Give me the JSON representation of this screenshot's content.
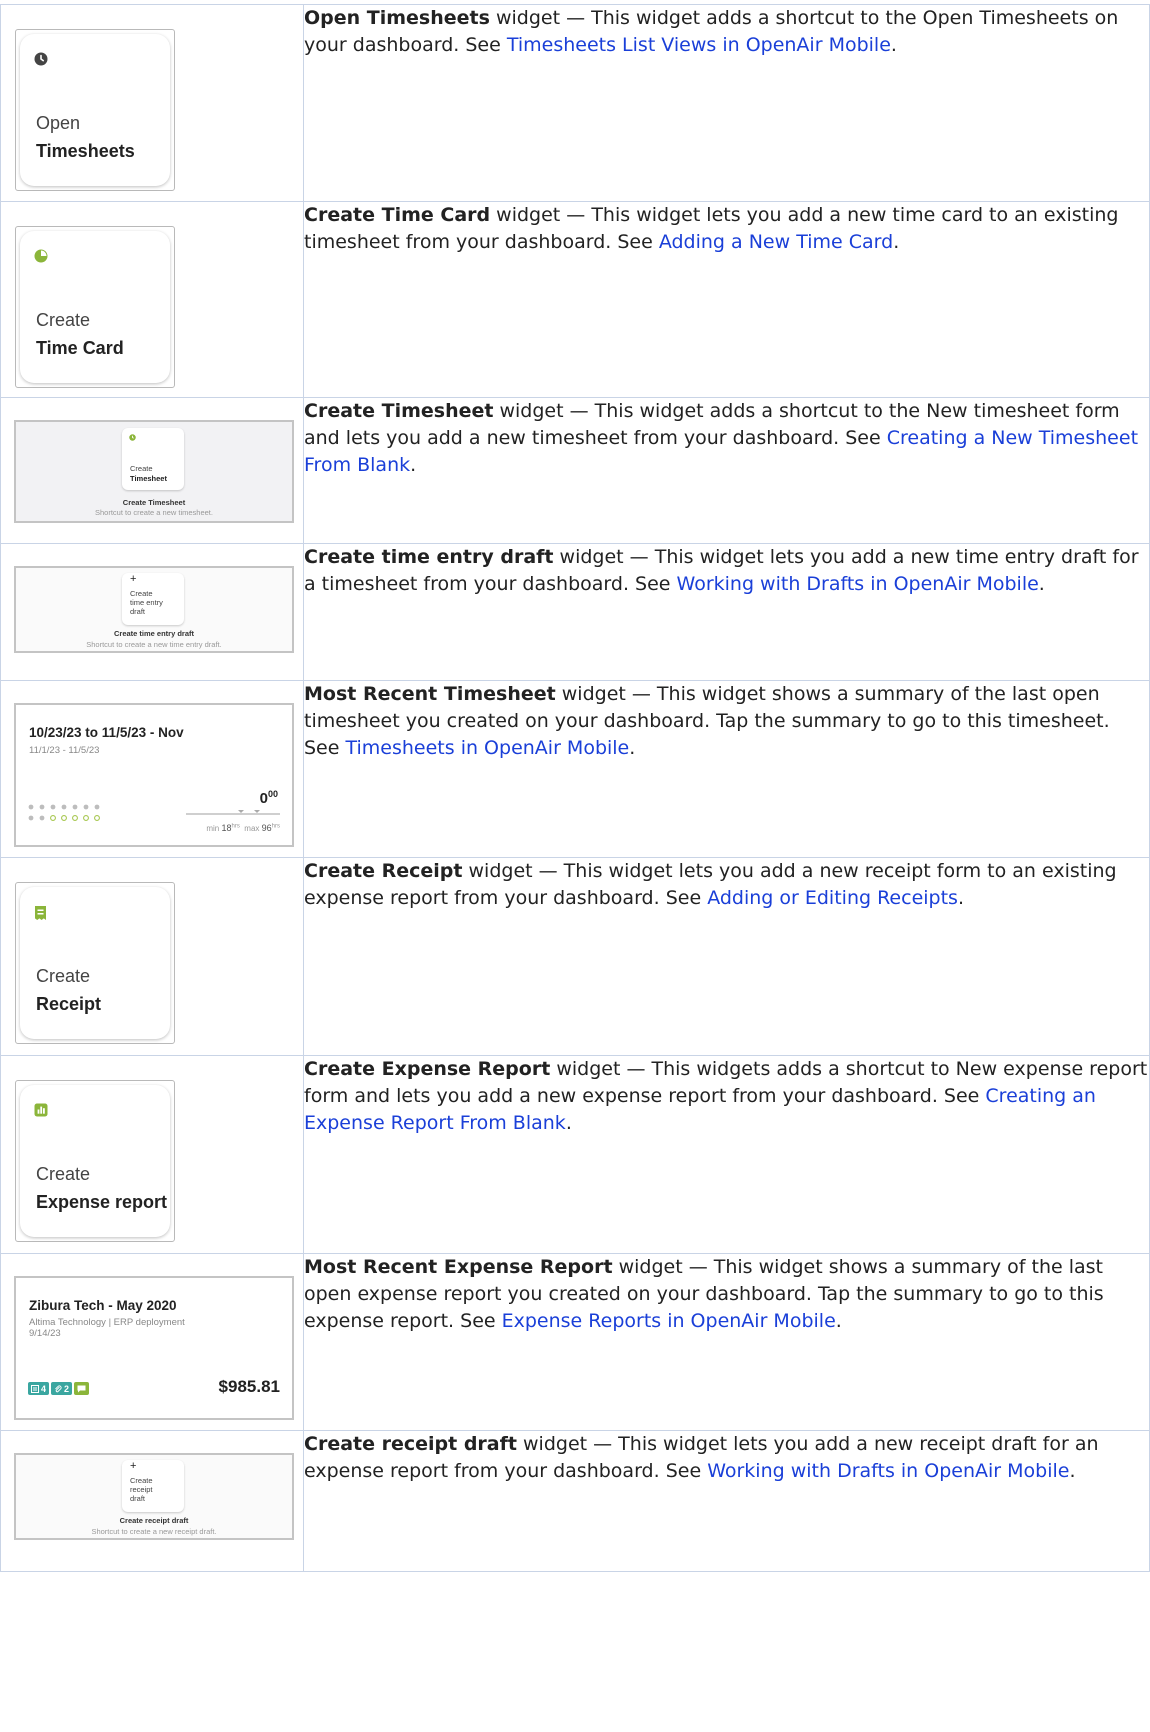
{
  "rows": [
    {
      "widget_name": "Open Timesheets",
      "text_before": " widget — This widget adds a shortcut to the Open Timesheets on your dashboard. See ",
      "link": "Timesheets List Views in OpenAir Mobile",
      "text_after": ".",
      "image": {
        "line1": "Open",
        "line2": "Timesheets",
        "icon": "clock-icon",
        "icon_color": "#444444"
      }
    },
    {
      "widget_name": "Create Time Card",
      "text_before": " widget — This widget lets you add a new time card to an existing timesheet from your dashboard. See ",
      "link": "Adding a New Time Card",
      "text_after": ".",
      "image": {
        "line1": "Create",
        "line2": "Time Card",
        "icon": "pie-clock-icon",
        "icon_color": "#8bb53a"
      }
    },
    {
      "widget_name": "Create Timesheet",
      "text_before": " widget — This widget adds a shortcut to the New timesheet form and lets you add a new timesheet from your dashboard. See ",
      "link": "Creating a New Timesheet From Blank",
      "text_after": ".",
      "image": {
        "line1": "Create",
        "line2": "Timesheet",
        "caption": "Create Timesheet",
        "subcaption": "Shortcut to create a new timesheet.",
        "icon": "clock-icon",
        "icon_color": "#8bb53a"
      }
    },
    {
      "widget_name": "Create time entry draft",
      "text_before": " widget — This widget lets you add a new time entry draft for a timesheet from your dashboard. See ",
      "link": "Working with Drafts in OpenAir Mobile",
      "text_after": ".",
      "image": {
        "plus": "+",
        "line1": "Create",
        "line2": "time entry",
        "line3": "draft",
        "caption": "Create time entry draft",
        "subcaption": "Shortcut to create a new time entry draft."
      }
    },
    {
      "widget_name": "Most Recent Timesheet",
      "text_before": " widget — This widget shows a summary of the last open timesheet you created on your dashboard. Tap the summary to go to this timesheet. See ",
      "link": "Timesheets in OpenAir Mobile",
      "text_after": ".",
      "image": {
        "title": "10/23/23 to 11/5/23 - Nov",
        "subtitle": "11/1/23 - 11/5/23",
        "hours": "0",
        "hours_sup": "00",
        "min_label": "min",
        "min_value": "18",
        "min_unit": "hrs",
        "max_label": "max",
        "max_value": "96",
        "max_unit": "hrs"
      }
    },
    {
      "widget_name": "Create Receipt",
      "text_before": " widget — This widget lets you add a new receipt form to an existing expense report from your dashboard. See ",
      "link": "Adding or Editing Receipts",
      "text_after": ".",
      "image": {
        "line1": "Create",
        "line2": "Receipt",
        "icon": "receipt-icon",
        "icon_color": "#8bb53a"
      }
    },
    {
      "widget_name": "Create Expense Report",
      "text_before": " widget — This widgets adds a shortcut to New expense report form and lets you add a new expense report from your dashboard. See ",
      "link": "Creating an Expense Report From Blank",
      "text_after": ".",
      "image": {
        "line1": "Create",
        "line2": "Expense report",
        "icon": "expense-report-icon",
        "icon_color": "#8bb53a"
      }
    },
    {
      "widget_name": "Most Recent Expense Report",
      "text_before": " widget — This widget shows a summary of the last open expense report you created on your dashboard. Tap the summary to go to this expense report. See ",
      "link": "Expense Reports in OpenAir Mobile",
      "text_after": ".",
      "image": {
        "title": "Zibura Tech - May 2020",
        "subtitle": "Altima Technology | ERP deployment",
        "date": "9/14/23",
        "badge1": "4",
        "badge2": "2",
        "amount": "$985.81",
        "badge_color": "#3aa6a0"
      }
    },
    {
      "widget_name": "Create receipt draft",
      "text_before": " widget — This widget lets you add a new receipt draft for an expense report from your dashboard. See ",
      "link": "Working with Drafts in OpenAir Mobile",
      "text_after": ".",
      "image": {
        "plus": "+",
        "line1": "Create",
        "line2": "receipt",
        "line3": "draft",
        "caption": "Create receipt draft",
        "subcaption": "Shortcut to create a new receipt draft."
      }
    }
  ]
}
